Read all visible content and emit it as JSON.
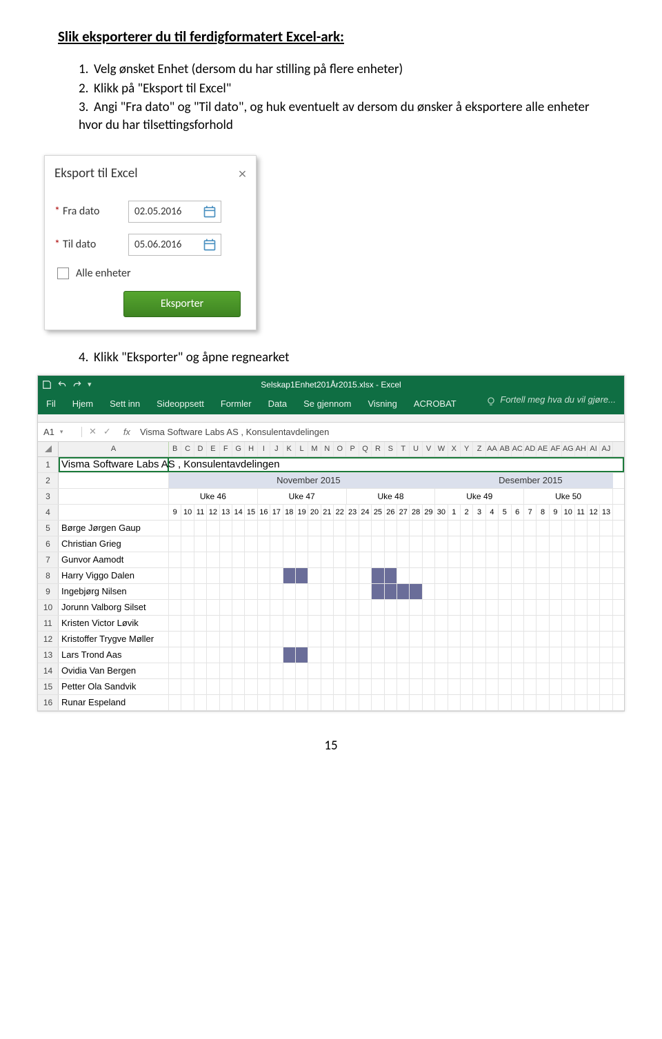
{
  "heading": "Slik eksporterer du til ferdigformatert Excel-ark:",
  "steps": {
    "s1": "Velg ønsket Enhet (dersom du har stilling på flere enheter)",
    "s2": "Klikk på \"Eksport til Excel\"",
    "s3": "Angi \"Fra dato\" og \"Til dato\", og huk eventuelt av dersom du ønsker å eksportere alle enheter hvor du har tilsettingsforhold",
    "s4": "Klikk \"Eksporter\" og åpne regnearket"
  },
  "nums": {
    "n1": "1.",
    "n2": "2.",
    "n3": "3.",
    "n4": "4."
  },
  "dialog": {
    "title": "Eksport til Excel",
    "fra_label": "Fra dato",
    "til_label": "Til dato",
    "fra_value": "02.05.2016",
    "til_value": "05.06.2016",
    "alle": "Alle enheter",
    "export": "Eksporter"
  },
  "excel": {
    "title": "Selskap1Enhet201År2015.xlsx - Excel",
    "tabs": [
      "Fil",
      "Hjem",
      "Sett inn",
      "Sideoppsett",
      "Formler",
      "Data",
      "Se gjennom",
      "Visning",
      "ACROBAT"
    ],
    "tell": "Fortell meg hva du vil gjøre...",
    "namebox": "A1",
    "fx": "fx",
    "formula": "Visma Software Labs AS , Konsulentavdelingen",
    "col_a_letter": "A",
    "col_letters": [
      "B",
      "C",
      "D",
      "E",
      "F",
      "G",
      "H",
      "I",
      "J",
      "K",
      "L",
      "M",
      "N",
      "O",
      "P",
      "Q",
      "R",
      "S",
      "T",
      "U",
      "V",
      "W",
      "X",
      "Y",
      "Z",
      "AA",
      "AB",
      "AC",
      "AD",
      "AE",
      "AF",
      "AG",
      "AH",
      "AI",
      "AJ"
    ],
    "row1": "Visma Software Labs AS , Konsulentavdelingen",
    "months": {
      "nov": "November 2015",
      "des": "Desember 2015"
    },
    "weeks": [
      "Uke 46",
      "Uke 47",
      "Uke 48",
      "Uke 49",
      "Uke 50"
    ],
    "days": [
      "9",
      "10",
      "11",
      "12",
      "13",
      "14",
      "15",
      "16",
      "17",
      "18",
      "19",
      "20",
      "21",
      "22",
      "23",
      "24",
      "25",
      "26",
      "27",
      "28",
      "29",
      "30",
      "1",
      "2",
      "3",
      "4",
      "5",
      "6",
      "7",
      "8",
      "9",
      "10",
      "11",
      "12",
      "13"
    ],
    "names": [
      "Børge Jørgen Gaup",
      "Christian Grieg",
      "Gunvor Aamodt",
      "Harry Viggo Dalen",
      "Ingebjørg Nilsen",
      "Jorunn Valborg Silset",
      "Kristen Victor Løvik",
      "Kristoffer Trygve Møller",
      "Lars Trond Aas",
      "Ovidia Van Bergen",
      "Petter Ola Sandvik",
      "Runar Espeland"
    ],
    "filled": {
      "Harry Viggo Dalen": [
        9,
        10,
        16,
        17
      ],
      "Ingebjørg Nilsen": [
        16,
        17,
        18,
        19
      ],
      "Lars Trond Aas": [
        9,
        10
      ]
    }
  },
  "page_number": "15"
}
